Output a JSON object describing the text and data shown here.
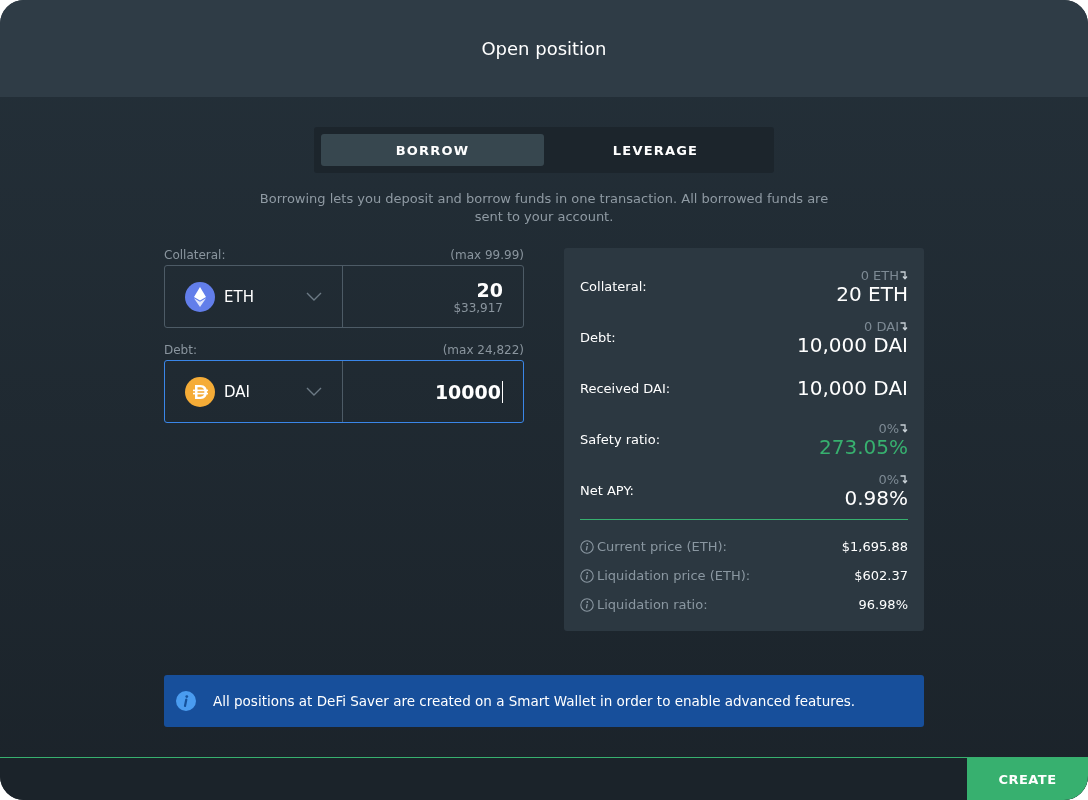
{
  "title": "Open position",
  "tabs": [
    {
      "label": "BORROW",
      "selected": true
    },
    {
      "label": "LEVERAGE",
      "selected": false
    }
  ],
  "description": "Borrowing lets you deposit and borrow funds in one transaction. All borrowed funds are sent to your account.",
  "inputs": [
    {
      "label": "Collateral:",
      "max": "(max 99.99)",
      "asset": "ETH",
      "kind": "eth",
      "value": "20",
      "usd": "$33,917",
      "focused": false
    },
    {
      "label": "Debt:",
      "max": "(max 24,822)",
      "asset": "DAI",
      "kind": "dai",
      "value": "10000",
      "focused": true
    }
  ],
  "stats": [
    {
      "label": "Collateral:",
      "previous": "0 ETH",
      "value": "20 ETH",
      "color": "#ffffff"
    },
    {
      "label": "Debt:",
      "previous": "0 DAI",
      "value": "10,000 DAI",
      "color": "#ffffff"
    },
    {
      "label": "Received DAI:",
      "value": "10,000 DAI",
      "color": "#ffffff"
    },
    {
      "label": "Safety ratio:",
      "previous": "0%",
      "value": "273.05%",
      "color": "#37b06f"
    },
    {
      "label": "Net APY:",
      "previous": "0%",
      "value": "0.98%",
      "color": "#ffffff"
    }
  ],
  "details": [
    {
      "label": "Current price (ETH):",
      "value": "$1,695.88"
    },
    {
      "label": "Liquidation price (ETH):",
      "value": "$602.37"
    },
    {
      "label": "Liquidation ratio:",
      "value": "96.98%"
    }
  ],
  "notice": "All positions at DeFi Saver are created on a Smart Wallet in order to enable advanced features.",
  "create_button": "CREATE"
}
